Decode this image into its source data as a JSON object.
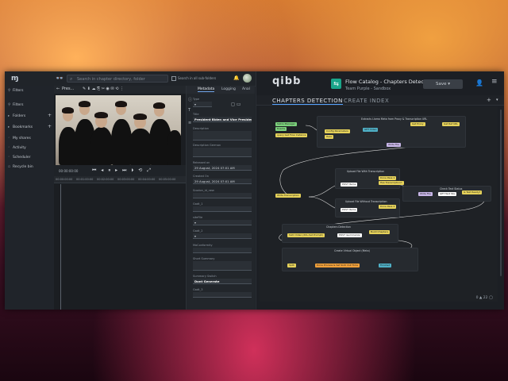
{
  "left_app": {
    "search_placeholder": "Search in chapter directory, folder",
    "search_all_label": "Search in all sub-folders",
    "sidebar": {
      "items": [
        {
          "label": "Filters"
        },
        {
          "label": "Filters"
        },
        {
          "label": "Folders"
        },
        {
          "label": "Bookmarks"
        },
        {
          "label": "My shares"
        },
        {
          "label": "Activity"
        },
        {
          "label": "Scheduler"
        },
        {
          "label": "Recycle bin"
        }
      ]
    },
    "player": {
      "toolbar_title": "Pres...",
      "timecode": "00:00:00:00",
      "ruler_ticks": [
        "00:00:00:00",
        "00:01:00:00",
        "00:02:00:00",
        "00:03:00:00",
        "00:04:00:00",
        "00:05:00:00"
      ]
    },
    "metadata": {
      "tabs": [
        "Metadata",
        "Logging",
        "Anal"
      ],
      "fields": [
        {
          "label": "Type",
          "value": ""
        },
        {
          "label": "Title",
          "value": "President Biden and Vice President H..."
        },
        {
          "label": "Description",
          "value": ""
        },
        {
          "label": "Description German",
          "value": ""
        },
        {
          "label": "Released on",
          "value": "29 August, 2024 07:01 AM"
        },
        {
          "label": "Created On",
          "value": "29 August, 2024 07:01 AM"
        },
        {
          "label": "Scodon_id_new",
          "value": ""
        },
        {
          "label": "Gadt_1",
          "value": ""
        },
        {
          "label": "siteFile",
          "value": ""
        },
        {
          "label": "Gadt_2",
          "value": ""
        },
        {
          "label": "MaConformity",
          "value": ""
        },
        {
          "label": "Short Summary",
          "value": ""
        },
        {
          "label": "Summary Switch",
          "value": "Dont Generate"
        },
        {
          "label": "Gadt_3",
          "value": ""
        }
      ]
    }
  },
  "right_app": {
    "logo": "qibb",
    "flow_title": "Flow Catalog - Chapters Detection",
    "flow_subtitle": "Team Purple - Sandbox",
    "save_label": "Save",
    "tabs": [
      "CHAPTERS DETECTION",
      "CREATE INDEX"
    ],
    "groups": [
      {
        "label": "Extracts Llama Meta from Proxy & Transcription URL"
      },
      {
        "label": "Upload File With Transcription"
      },
      {
        "label": "Check Text Status"
      },
      {
        "label": "Upload File Without Transcription"
      },
      {
        "label": "Chapters Detection"
      },
      {
        "label": "Create Virtual Object (Meta)"
      }
    ],
    "nodes": [
      {
        "label": "Sixtro Manager"
      },
      {
        "label": "Events"
      },
      {
        "label": "query Get Flow Instance"
      },
      {
        "label": "Config Parameters"
      },
      {
        "label": "Helic"
      },
      {
        "label": "GET Video"
      },
      {
        "label": "Get Proxy"
      },
      {
        "label": "Write Transcription"
      },
      {
        "label": "Get Ref URL"
      },
      {
        "label": "Write File"
      },
      {
        "label": "Has Transcription?"
      },
      {
        "label": "POST Items"
      },
      {
        "label": "Done Pass 1"
      },
      {
        "label": "Write File"
      },
      {
        "label": "GET Text Sta"
      },
      {
        "label": "Is Text Ready?"
      },
      {
        "label": "POST Items"
      },
      {
        "label": "Done Pass 2"
      },
      {
        "label": "Sixtr Video (XCL-Set Prompt)"
      },
      {
        "label": "POST /summarize"
      },
      {
        "label": "Build Chapters"
      },
      {
        "label": "Split"
      },
      {
        "label": "Done Process & Set Sixtr Out Time"
      },
      {
        "label": "Finished"
      }
    ],
    "status": "0 ▲ 22 ◯"
  }
}
